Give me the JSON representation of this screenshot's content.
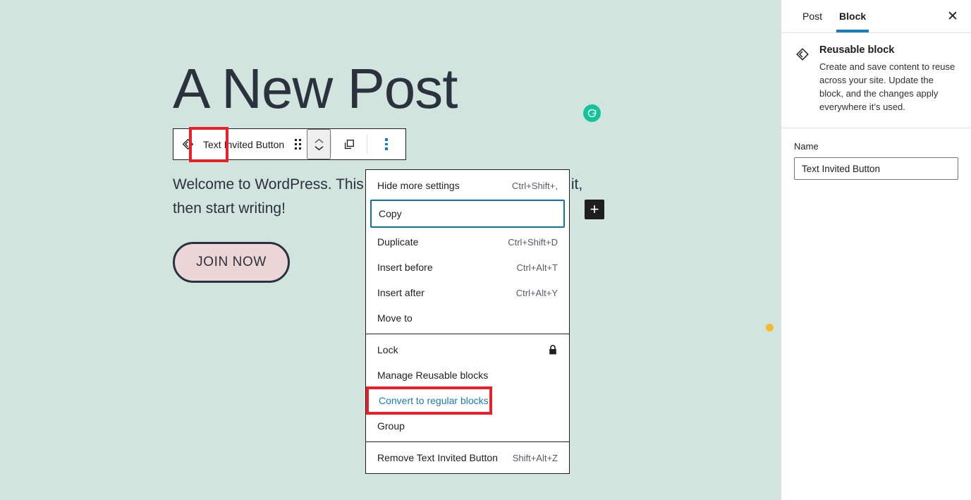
{
  "canvas": {
    "title": "A New Post",
    "paragraph": "Welcome to WordPress. This is your first post. Edit or delete it, then start writing!",
    "button_label": "JOIN NOW",
    "inserter_label": "+",
    "background_color": "#d2e4de",
    "button_fill": "#ecd5d7",
    "button_border": "#2b313d",
    "grammarly_color": "#15c39a",
    "dot_marker_color": "#f7b731"
  },
  "toolbar": {
    "block_icon": "reusable-block-icon",
    "block_name": "Text Invited Button",
    "drag_icon": "drag-handle-icon",
    "movers_icon": "move-up-down-icon",
    "copy_icon": "copy-block-icon",
    "more_icon": "vertical-ellipsis-icon",
    "annotation_color": "#e8202a",
    "active_icon_color": "#1b7bb5"
  },
  "menu": {
    "groups": [
      {
        "items": [
          {
            "label": "Hide more settings",
            "shortcut": "Ctrl+Shift+,",
            "state": "normal"
          },
          {
            "label": "Copy",
            "shortcut": "",
            "state": "focused"
          },
          {
            "label": "Duplicate",
            "shortcut": "Ctrl+Shift+D",
            "state": "normal"
          },
          {
            "label": "Insert before",
            "shortcut": "Ctrl+Alt+T",
            "state": "normal"
          },
          {
            "label": "Insert after",
            "shortcut": "Ctrl+Alt+Y",
            "state": "normal"
          },
          {
            "label": "Move to",
            "shortcut": "",
            "state": "normal"
          }
        ]
      },
      {
        "items": [
          {
            "label": "Lock",
            "shortcut": "",
            "state": "lock"
          },
          {
            "label": "Manage Reusable blocks",
            "shortcut": "",
            "state": "normal"
          },
          {
            "label": "Convert to regular blocks",
            "shortcut": "",
            "state": "annotated"
          },
          {
            "label": "Group",
            "shortcut": "",
            "state": "normal"
          }
        ]
      },
      {
        "items": [
          {
            "label": "Remove Text Invited Button",
            "shortcut": "Shift+Alt+Z",
            "state": "normal"
          }
        ]
      }
    ],
    "focus_ring_color": "#0a75b0",
    "annotation_color": "#e8202a",
    "link_color": "#1b7bb5"
  },
  "sidebar": {
    "tabs": [
      {
        "label": "Post",
        "active": false
      },
      {
        "label": "Block",
        "active": true
      }
    ],
    "close_label": "✕",
    "block": {
      "icon": "reusable-block-icon",
      "title": "Reusable block",
      "description": "Create and save content to reuse across your site. Update the block, and the changes apply everywhere it’s used."
    },
    "name_field": {
      "label": "Name",
      "value": "Text Invited Button",
      "placeholder": "Name"
    },
    "accent_color": "#1b7bb5"
  }
}
